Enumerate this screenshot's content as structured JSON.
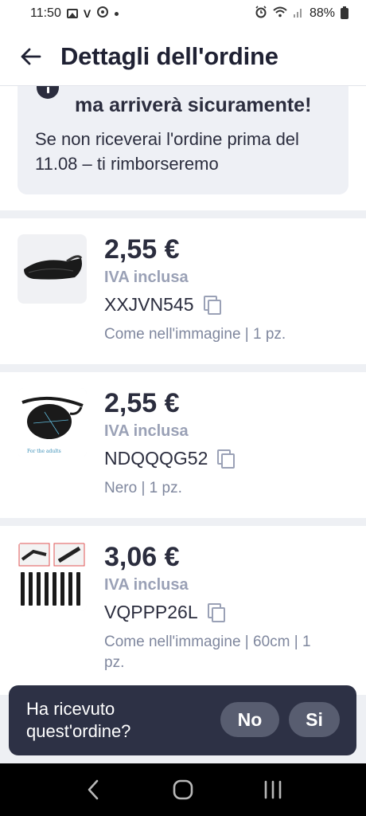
{
  "status_bar": {
    "time": "11:50",
    "left_icons": [
      "gallery-icon",
      "v-icon",
      "refresh-icon",
      "dot-icon"
    ],
    "right_icons": [
      "alarm-icon",
      "wifi-icon",
      "signal-icon"
    ],
    "battery": "88%"
  },
  "header": {
    "title": "Dettagli dell'ordine",
    "back_icon": "arrow-left-icon"
  },
  "notice": {
    "icon": "info-icon",
    "bold_text": "ma arriverà sicuramente!",
    "text": "Se non riceverai l'ordine prima del 11.08 – ti rimborseremo"
  },
  "items": [
    {
      "price": "2,55 €",
      "vat": "IVA inclusa",
      "code": "XXJVN545",
      "variant": "Come nell'immagine | 1 pz."
    },
    {
      "price": "2,55 €",
      "vat": "IVA inclusa",
      "code": "NDQQQG52",
      "variant": "Nero | 1 pz.",
      "image_caption": "For the adults"
    },
    {
      "price": "3,06 €",
      "vat": "IVA inclusa",
      "code": "VQPPP26L",
      "variant": "Come nell'immagine | 60cm | 1 pz."
    }
  ],
  "prompt": {
    "question": "Ha ricevuto quest'ordine?",
    "no_label": "No",
    "yes_label": "Si"
  },
  "colors": {
    "accent_dark": "#2d3145",
    "text_primary": "#2b2d3e",
    "text_muted": "#9aa1b6",
    "background": "#eef0f4"
  }
}
